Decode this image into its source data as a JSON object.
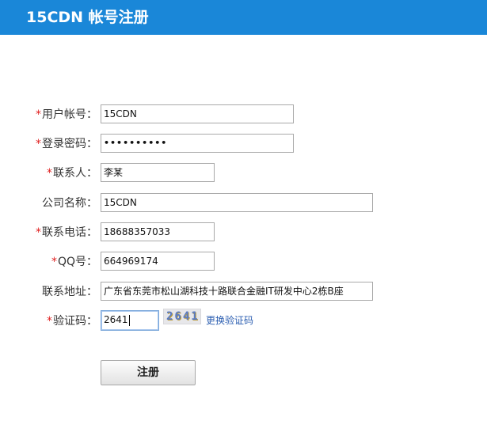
{
  "header": {
    "title": "15CDN 帐号注册",
    "background": "#1a87d8"
  },
  "form": {
    "fields": [
      {
        "id": "username",
        "label": "用户帐号：",
        "required": true,
        "value": "15CDN"
      },
      {
        "id": "password",
        "label": "登录密码：",
        "required": true,
        "value": "••••••••••"
      },
      {
        "id": "contact",
        "label": "联系人：",
        "required": true,
        "value": "李某"
      },
      {
        "id": "company",
        "label": "公司名称：",
        "required": false,
        "value": "15CDN"
      },
      {
        "id": "phone",
        "label": "联系电话：",
        "required": true,
        "value": "18688357033"
      },
      {
        "id": "qq",
        "label": "QQ号：",
        "required": true,
        "value": "664969174"
      },
      {
        "id": "address",
        "label": "联系地址：",
        "required": false,
        "value": "广东省东莞市松山湖科技十路联合金融IT研发中心2栋B座"
      },
      {
        "id": "captcha",
        "label": "验证码：",
        "required": true,
        "value": "2641"
      }
    ],
    "required_mark": "*",
    "captcha_image_text": "2641",
    "captcha_refresh_link": "更换验证码",
    "submit_label": "注册"
  }
}
